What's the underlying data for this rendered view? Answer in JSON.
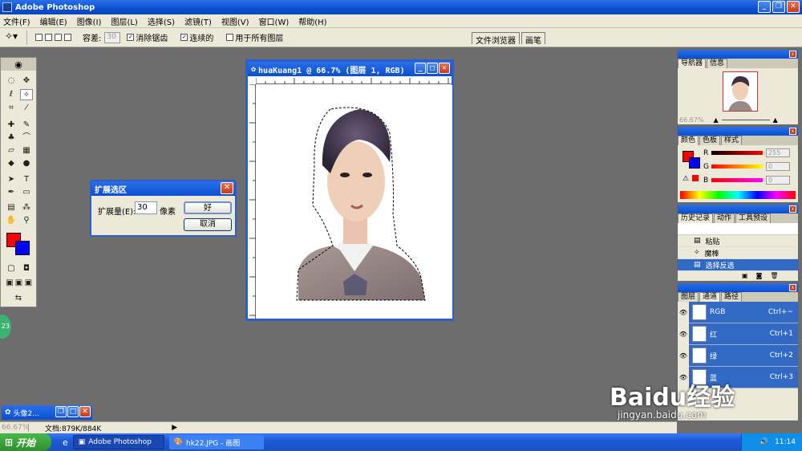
{
  "window": {
    "title": "Adobe Photoshop"
  },
  "menu": [
    "文件(F)",
    "编辑(E)",
    "图像(I)",
    "图层(L)",
    "选择(S)",
    "滤镜(T)",
    "视图(V)",
    "窗口(W)",
    "帮助(H)"
  ],
  "options": {
    "tolerance_label": "容差:",
    "tolerance_value": "30",
    "antialias_label": "消除锯齿",
    "contiguous_label": "连续的",
    "all_layers_label": "用于所有图层",
    "tab_file_browser": "文件浏览器",
    "tab_brushes": "画笔"
  },
  "document": {
    "title": "huaKuang1 @ 66.7% (图层 1, RGB)"
  },
  "dialog": {
    "title": "扩展选区",
    "expand_label": "扩展量(E):",
    "expand_value": "30",
    "unit": "像素",
    "ok": "好",
    "cancel": "取消"
  },
  "navigator": {
    "tabs": [
      "导航器",
      "信息"
    ],
    "zoom": "66.67%"
  },
  "color": {
    "tabs": [
      "颜色",
      "色板",
      "样式"
    ],
    "channels": [
      {
        "name": "R",
        "value": "255"
      },
      {
        "name": "G",
        "value": "0"
      },
      {
        "name": "B",
        "value": "0"
      }
    ],
    "fg_color": "#ff0000",
    "bg_color": "#0000ff"
  },
  "history": {
    "tabs": [
      "历史记录",
      "动作",
      "工具预设"
    ],
    "items": [
      "粘贴",
      "魔棒",
      "选择反选"
    ],
    "selected_index": 2
  },
  "channels": {
    "tabs": [
      "图层",
      "通道",
      "路径"
    ],
    "rows": [
      {
        "name": "RGB",
        "shortcut": "Ctrl+~"
      },
      {
        "name": "红",
        "shortcut": "Ctrl+1"
      },
      {
        "name": "绿",
        "shortcut": "Ctrl+2"
      },
      {
        "name": "蓝",
        "shortcut": "Ctrl+3"
      }
    ]
  },
  "minimized_doc": {
    "title": "头像2..."
  },
  "status": {
    "zoom": "66.67%",
    "doc_size": "文档:879K/884K"
  },
  "taskbar": {
    "start": "开始",
    "tasks": [
      "Adobe Photoshop",
      "hk22.JPG - 画图"
    ],
    "clock": "11:14"
  },
  "watermark": {
    "brand": "Baidu经验",
    "url": "jingyan.baidu.com"
  },
  "float_badge": "23"
}
